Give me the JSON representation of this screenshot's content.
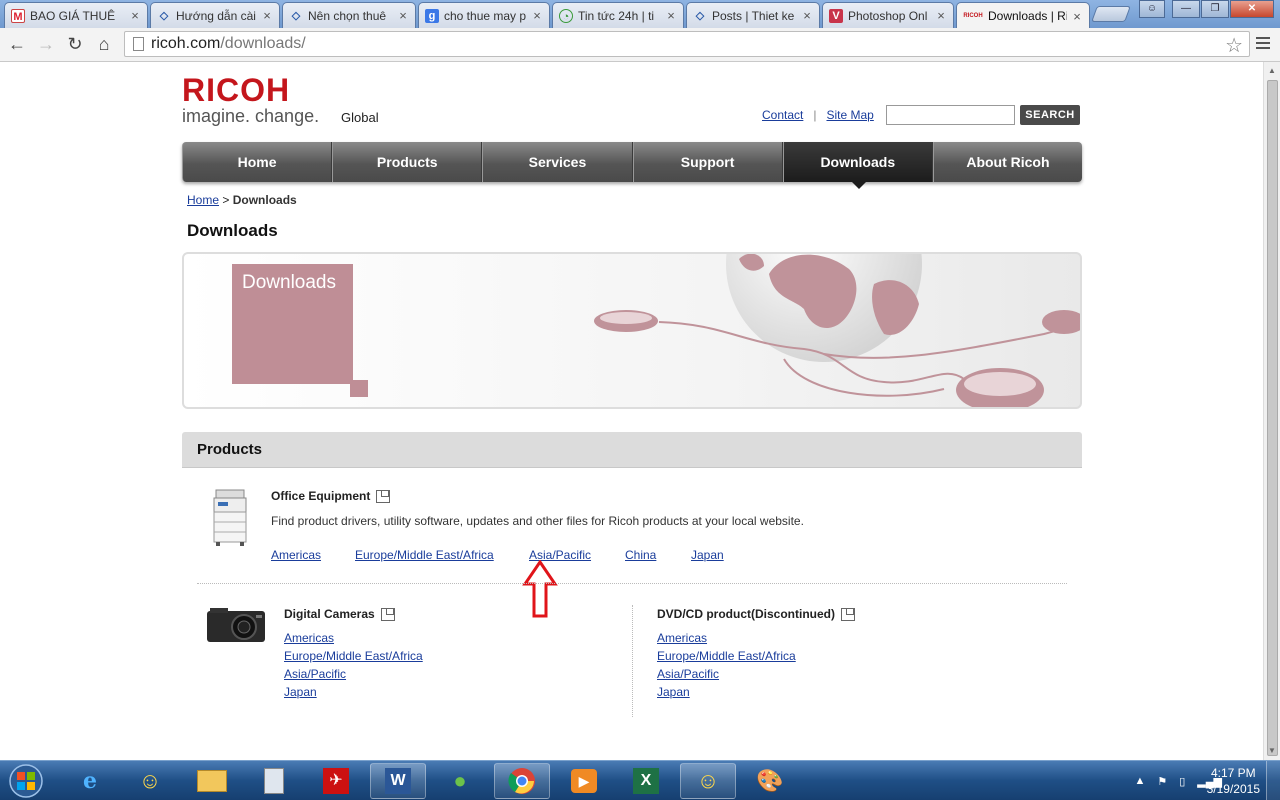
{
  "browser": {
    "tabs": [
      {
        "label": "BAO GIÁ THUÊ",
        "icon": "gmail-icon"
      },
      {
        "label": "Hướng dẫn cài",
        "icon": "blogger-diamond-icon"
      },
      {
        "label": "Nên chọn thuê",
        "icon": "blogger-diamond-icon"
      },
      {
        "label": "cho thue may p",
        "icon": "google-g-icon"
      },
      {
        "label": "Tin tức 24h | ti",
        "icon": "clock-icon"
      },
      {
        "label": "Posts | Thiet ke",
        "icon": "blogger-diamond-icon"
      },
      {
        "label": "Photoshop Onl",
        "icon": "v-logo-icon"
      },
      {
        "label": "Downloads | Ri",
        "icon": "ricoh-favicon"
      }
    ],
    "close_glyph": "×",
    "url_domain": "ricoh.com",
    "url_path": "/downloads/"
  },
  "header": {
    "logo_word": "RICOH",
    "logo_tagline": "imagine. change.",
    "region": "Global",
    "contact_link": "Contact",
    "separator": "|",
    "sitemap_link": "Site Map",
    "search_value": "",
    "search_button": "SEARCH"
  },
  "nav": {
    "items": [
      "Home",
      "Products",
      "Services",
      "Support",
      "Downloads",
      "About Ricoh"
    ],
    "active": "Downloads"
  },
  "breadcrumb": {
    "home": "Home",
    "sep": ">",
    "current": "Downloads"
  },
  "page_title": "Downloads",
  "banner": {
    "label": "Downloads"
  },
  "products": {
    "heading": "Products",
    "office": {
      "title": "Office Equipment",
      "description": "Find product drivers, utility software, updates and other files for Ricoh products at your local website.",
      "links": [
        "Americas",
        "Europe/Middle East/Africa",
        "Asia/Pacific",
        "China",
        "Japan"
      ]
    },
    "cameras": {
      "title": "Digital Cameras",
      "links": [
        "Americas",
        "Europe/Middle East/Africa",
        "Asia/Pacific",
        "Japan"
      ]
    },
    "dvd": {
      "title": "DVD/CD product(Discontinued)",
      "links": [
        "Americas",
        "Europe/Middle East/Africa",
        "Asia/Pacific",
        "Japan"
      ]
    }
  },
  "taskbar": {
    "apps": [
      "internet-explorer-icon",
      "yahoo-messenger-icon",
      "file-explorer-icon",
      "calculator-icon",
      "acrobat-icon",
      "word-icon",
      "parrot-app-icon",
      "chrome-icon",
      "media-player-icon",
      "excel-icon",
      "yahoo-messenger-icon",
      "paint-icon"
    ],
    "time": "4:17 PM",
    "date": "3/19/2015"
  },
  "colors": {
    "ricoh_red": "#c4161c",
    "banner_pink": "#bf8e96",
    "link_blue": "#1a3d9b",
    "annotation_arrow": "#e0141a"
  }
}
